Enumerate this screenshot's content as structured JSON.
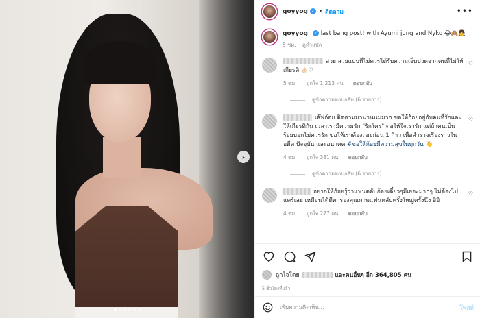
{
  "post": {
    "username": "goyyog",
    "follow_label": "ติดตาม",
    "more_label": "•••",
    "dot": "•",
    "caption_text": "last bang post! with Ayumi jung and Nyko 😂🙈👧",
    "caption_time": "5 ชม.",
    "translate_label": "ดูคำแปล"
  },
  "comments": [
    {
      "text": "สวย สวยแบบที่ไม่ควรได้รับความเจ็บปวดจากคนที่ไม่ให้เกียรติ 👌🏻♡",
      "time": "5 ชม.",
      "likes": "ถูกใจ 1,213 คน",
      "reply": "ตอบกลับ",
      "view_replies": "ดูข้อความตอบกลับ (6 รายการ)"
    },
    {
      "text": "เล๊ฟก้อย ติดตามมานานนมมาก ขอให้ก้อยอยู่กับคนที่รักและให้เกียรติกัน เวลาเรามีความรัก \"รักใคร\" ต่อให้ใจเรารัก แต่ถ้าคนเป็นร้อยบอกไม่ควรรัก ขอให้เราต้องถอยก่อน 1 ก้าว เพื่อสำรวจเรื่องราวในอดีต ปัจจุบัน และอนาคต",
      "hashtag": "#ขอให้ก้อยมีความสุขในทุกวัน",
      "emoji": "👋",
      "time": "4 ชม.",
      "likes": "ถูกใจ 381 คน",
      "reply": "ตอบกลับ",
      "view_replies": "ดูข้อความตอบกลับ (6 รายการ)"
    },
    {
      "text": "อยากให้ก้อยรู้ว่าแฟนคลับก้อยเดี๋ยวๆมีเยอะมากๆ ไม่ต้องไปแคร์เลย เหมือนได้ดีดกรองคุณภาพแฟนคลับครั้งใหญ่ครั้งนึง อิอิ",
      "time": "4 ชม.",
      "likes": "ถูกใจ 277 คน",
      "reply": "ตอบกลับ"
    }
  ],
  "likes_bar": {
    "prefix": "ถูกใจโดย",
    "others": "และคนอื่นๆ อีก 364,805 คน"
  },
  "time_ago": "5 ชั่วโมงที่แล้ว",
  "add_comment": {
    "placeholder": "เพิ่มความคิดเห็น...",
    "post_label": "โพสต์"
  },
  "icons": {
    "heart": "heart-icon",
    "comment": "comment-icon",
    "share": "share-icon",
    "bookmark": "bookmark-icon",
    "emoji": "emoji-icon",
    "verified": "verified-badge-icon",
    "next": "chevron-right-icon"
  },
  "colors": {
    "accent": "#0095f6",
    "hashtag": "#00376b",
    "muted": "#8e8e8e",
    "verified": "#3897f0"
  }
}
